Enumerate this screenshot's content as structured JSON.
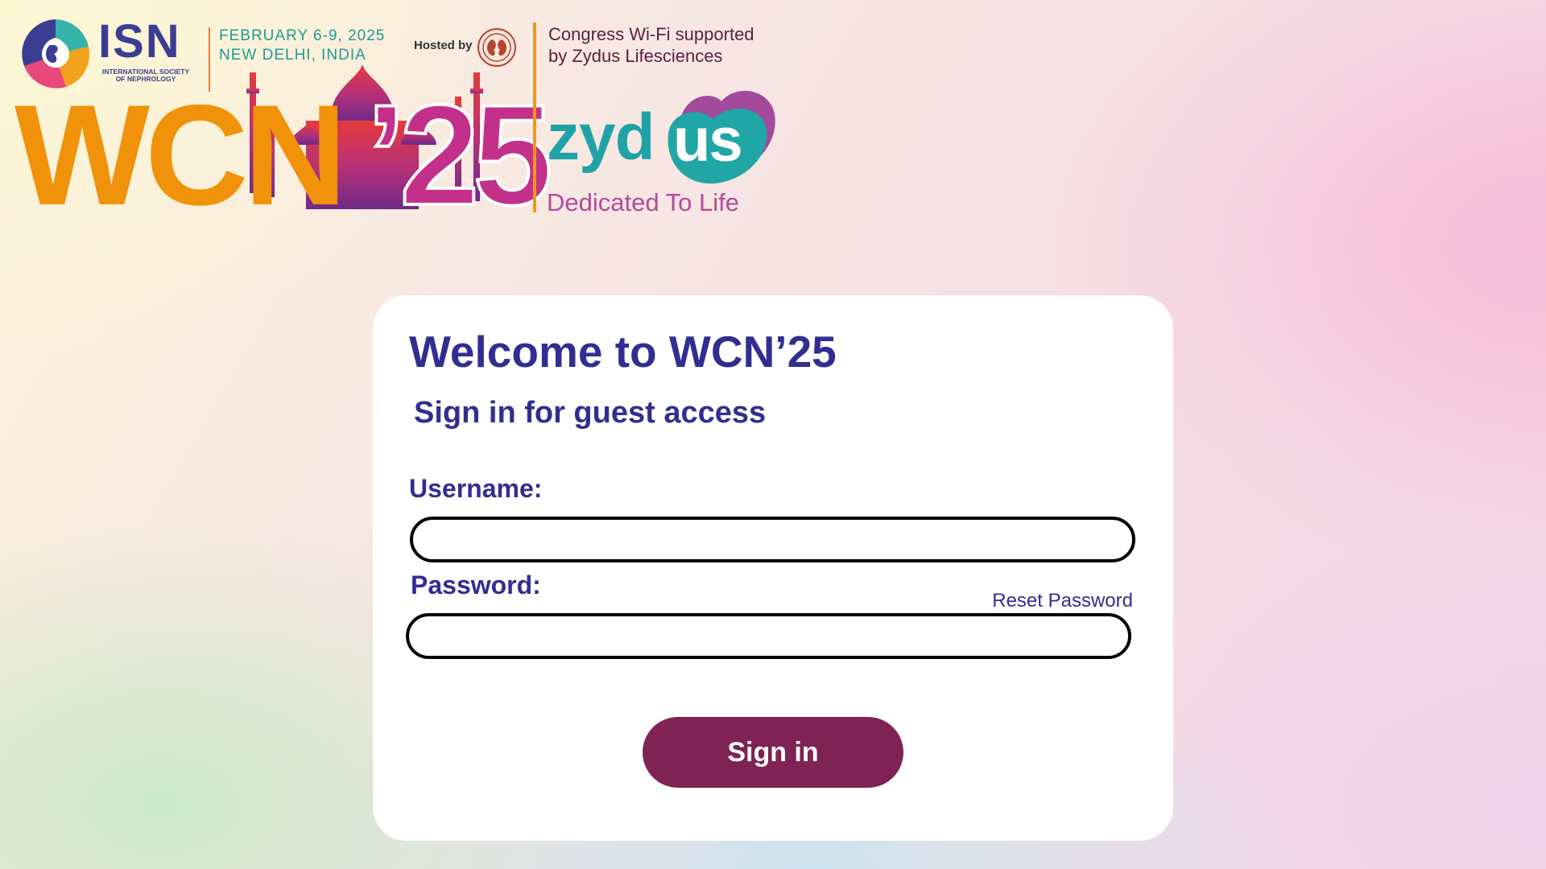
{
  "header": {
    "isn": {
      "name": "ISN",
      "full_name": "INTERNATIONAL SOCIETY OF NEPHROLOGY"
    },
    "event": {
      "date": "FEBRUARY 6-9, 2025",
      "location": "NEW DELHI, INDIA",
      "hosted_by": "Hosted by",
      "logo_main": "WCN",
      "logo_year": "’25"
    },
    "sponsor": {
      "wifi_line1": "Congress Wi-Fi supported",
      "wifi_line2": "by Zydus Lifesciences",
      "logo_part1": "zyd",
      "logo_part2": "us",
      "tagline": "Dedicated To Life"
    }
  },
  "login": {
    "title": "Welcome to WCN’25",
    "subtitle": "Sign in for guest access",
    "username_label": "Username:",
    "username_value": "",
    "password_label": "Password:",
    "password_value": "",
    "reset_link": "Reset Password",
    "submit_label": "Sign in"
  },
  "colors": {
    "title_text": "#312e91",
    "button_bg": "#7e2353",
    "wcn_orange": "#f1920b",
    "zydus_teal": "#20a3a6",
    "zydus_purple": "#b34a9c",
    "isn_blue": "#3b3d93"
  },
  "icons": [
    "isn-emblem-icon",
    "kidney-host-icon",
    "taj-mahal-skyline-icon",
    "zydus-heart-icon"
  ]
}
